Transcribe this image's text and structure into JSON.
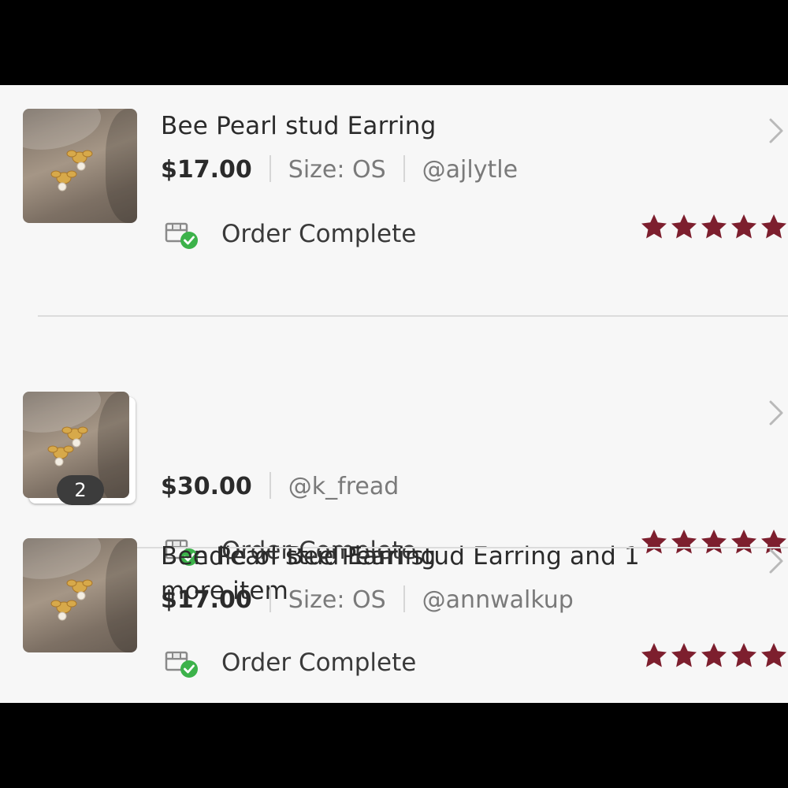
{
  "colors": {
    "star": "#7d1f2e",
    "check": "#3cb24a",
    "badge_bg": "#3c3c3c"
  },
  "orders": [
    {
      "title": "Bee Pearl stud Earring",
      "price": "$17.00",
      "size": "Size: OS",
      "seller": "@ajlytle",
      "status": "Order Complete",
      "rating": 5
    },
    {
      "title": "Bundle of Bee Pearl stud Earring and 1 more item",
      "price": "$30.00",
      "seller": "@k_fread",
      "item_count": "2",
      "status": "Order Complete",
      "rating": 5
    },
    {
      "title": "Bee Pearl stud Earring",
      "price": "$17.00",
      "size": "Size: OS",
      "seller": "@annwalkup",
      "status": "Order Complete",
      "rating": 5
    }
  ]
}
